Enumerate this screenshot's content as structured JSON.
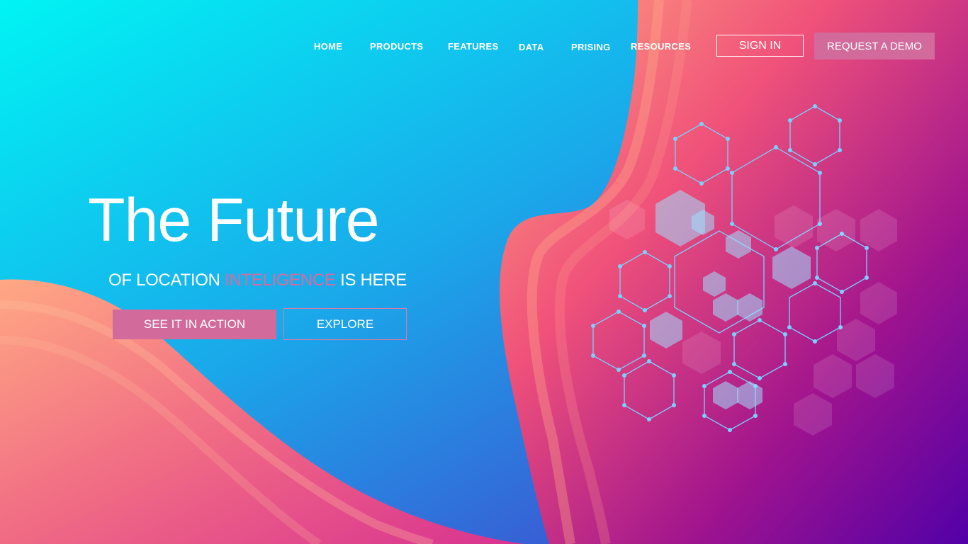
{
  "nav": {
    "items": [
      {
        "label": "HOME"
      },
      {
        "label": "PRODUCTS"
      },
      {
        "label": "FEATURES"
      },
      {
        "label": "DATA"
      },
      {
        "label": "PRISING"
      },
      {
        "label": "RESOURCES"
      }
    ],
    "sign_in": "SIGN IN",
    "request_demo": "REQUEST A DEMO"
  },
  "hero": {
    "title": "The Future",
    "subtitle_pre": "OF LOCATION ",
    "subtitle_accent": "INTELIGENCE",
    "subtitle_post": " IS HERE",
    "primary_cta": "SEE IT IN ACTION",
    "secondary_cta": "EXPLORE"
  },
  "colors": {
    "accent": "#d26a9c",
    "cyan": "#00f0f5",
    "blue": "#2f6fe0",
    "coral": "#ff8f7a",
    "magenta": "#e0307a",
    "purple": "#5a0aa8"
  }
}
